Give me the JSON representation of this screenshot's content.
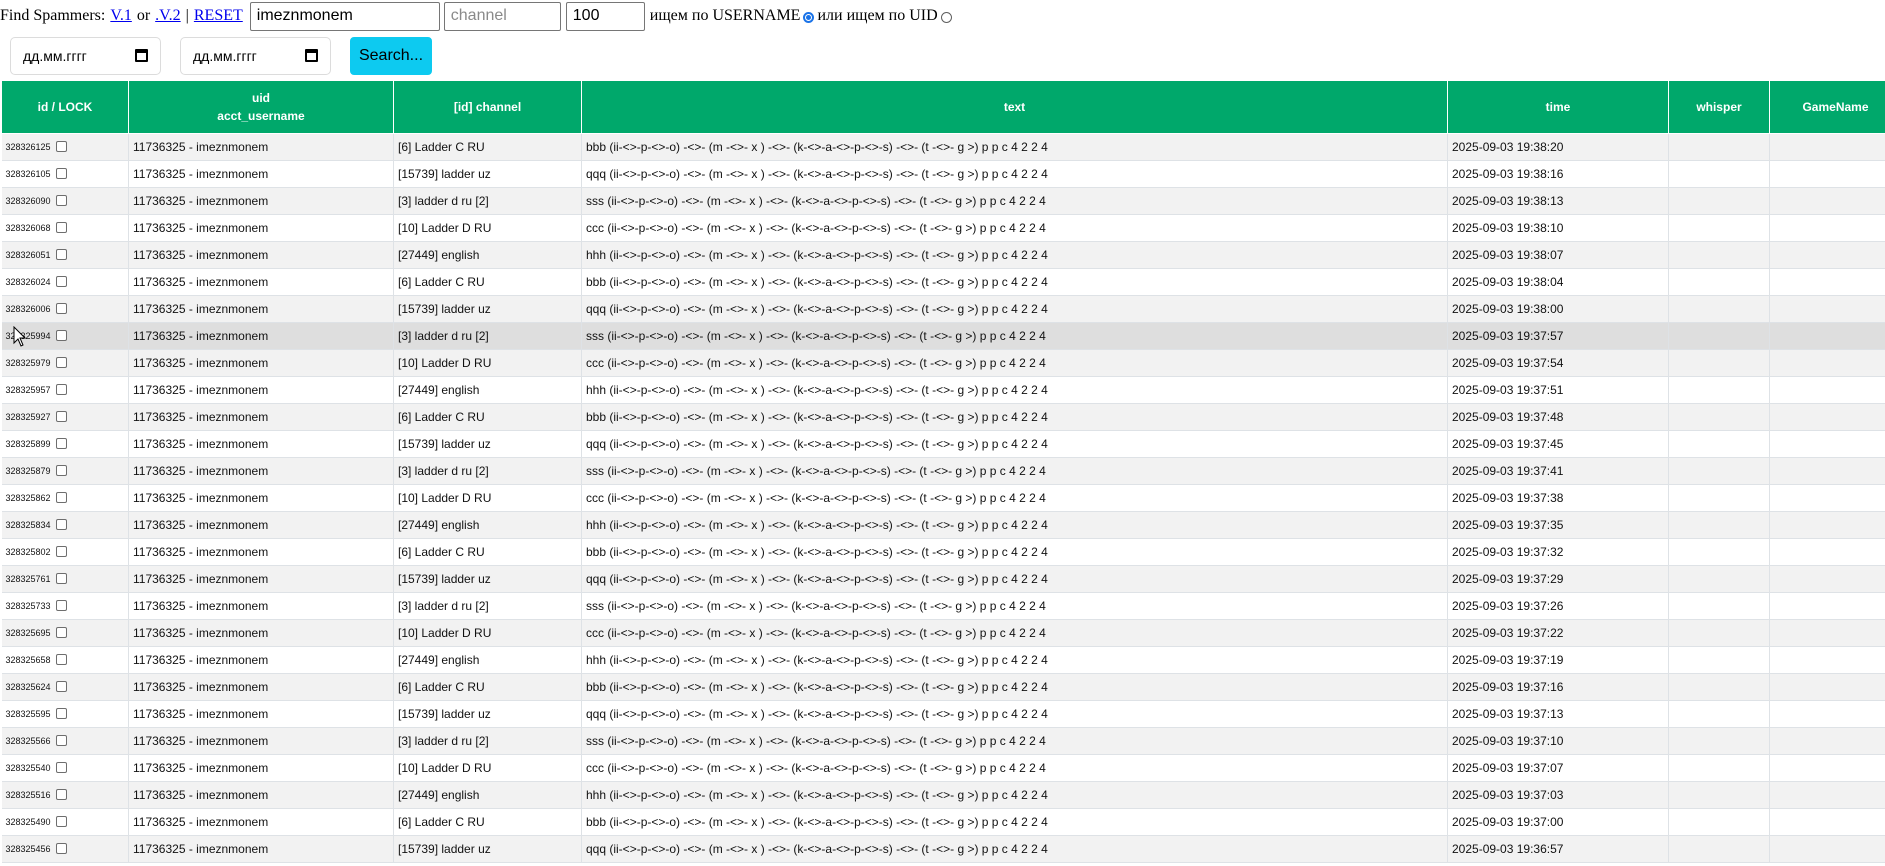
{
  "filters": {
    "find_label": "Find Spammers:",
    "v1_link": "V.1",
    "or_text": "or",
    "v2_link": ".V.2",
    "separator": "|",
    "reset_link": "RESET",
    "username_value": "imeznmonem",
    "channel_placeholder": "channel",
    "limit_value": "100",
    "by_username_label": "ищем по USERNAME",
    "by_uid_label": "или ищем по UID",
    "selected_mode": "username",
    "date_from_placeholder": "дд.мм.гггг",
    "date_to_placeholder": "дд.мм.гггг",
    "search_button": "Search..."
  },
  "colors": {
    "header_bg": "#00a86b",
    "button_bg": "#0dcaf0",
    "link": "#0000ee"
  },
  "table": {
    "columns": {
      "id_lock": "id / LOCK",
      "uid_line1": "uid",
      "uid_line2": "acct_username",
      "channel": "[id] channel",
      "text": "text",
      "time": "time",
      "whisper": "whisper",
      "gamename": "GameName"
    },
    "rows": [
      {
        "id": "328326125",
        "uid": "11736325 - imeznmonem",
        "channel": "[6] Ladder C RU",
        "text": "bbb (ii-<>-p-<>-o) -<>- (m -<>- x ) -<>- (k-<>-a-<>-p-<>-s) -<>- (t -<>- g >) p p c 4 2 2 4",
        "time": "2025-09-03 19:38:20"
      },
      {
        "id": "328326105",
        "uid": "11736325 - imeznmonem",
        "channel": "[15739] ladder uz",
        "text": "qqq (ii-<>-p-<>-o) -<>- (m -<>- x ) -<>- (k-<>-a-<>-p-<>-s) -<>- (t -<>- g >) p p c 4 2 2 4",
        "time": "2025-09-03 19:38:16"
      },
      {
        "id": "328326090",
        "uid": "11736325 - imeznmonem",
        "channel": "[3] ladder d ru [2]",
        "text": "sss (ii-<>-p-<>-o) -<>- (m -<>- x ) -<>- (k-<>-a-<>-p-<>-s) -<>- (t -<>- g >) p p c 4 2 2 4",
        "time": "2025-09-03 19:38:13"
      },
      {
        "id": "328326068",
        "uid": "11736325 - imeznmonem",
        "channel": "[10] Ladder D RU",
        "text": "ccc (ii-<>-p-<>-o) -<>- (m -<>- x ) -<>- (k-<>-a-<>-p-<>-s) -<>- (t -<>- g >) p p c 4 2 2 4",
        "time": "2025-09-03 19:38:10"
      },
      {
        "id": "328326051",
        "uid": "11736325 - imeznmonem",
        "channel": "[27449] english",
        "text": "hhh (ii-<>-p-<>-o) -<>- (m -<>- x ) -<>- (k-<>-a-<>-p-<>-s) -<>- (t -<>- g >) p p c 4 2 2 4",
        "time": "2025-09-03 19:38:07"
      },
      {
        "id": "328326024",
        "uid": "11736325 - imeznmonem",
        "channel": "[6] Ladder C RU",
        "text": "bbb (ii-<>-p-<>-o) -<>- (m -<>- x ) -<>- (k-<>-a-<>-p-<>-s) -<>- (t -<>- g >) p p c 4 2 2 4",
        "time": "2025-09-03 19:38:04"
      },
      {
        "id": "328326006",
        "uid": "11736325 - imeznmonem",
        "channel": "[15739] ladder uz",
        "text": "qqq (ii-<>-p-<>-o) -<>- (m -<>- x ) -<>- (k-<>-a-<>-p-<>-s) -<>- (t -<>- g >) p p c 4 2 2 4",
        "time": "2025-09-03 19:38:00"
      },
      {
        "id": "328325994",
        "uid": "11736325 - imeznmonem",
        "channel": "[3] ladder d ru [2]",
        "text": "sss (ii-<>-p-<>-o) -<>- (m -<>- x ) -<>- (k-<>-a-<>-p-<>-s) -<>- (t -<>- g >) p p c 4 2 2 4",
        "time": "2025-09-03 19:37:57",
        "hover": true
      },
      {
        "id": "328325979",
        "uid": "11736325 - imeznmonem",
        "channel": "[10] Ladder D RU",
        "text": "ccc (ii-<>-p-<>-o) -<>- (m -<>- x ) -<>- (k-<>-a-<>-p-<>-s) -<>- (t -<>- g >) p p c 4 2 2 4",
        "time": "2025-09-03 19:37:54"
      },
      {
        "id": "328325957",
        "uid": "11736325 - imeznmonem",
        "channel": "[27449] english",
        "text": "hhh (ii-<>-p-<>-o) -<>- (m -<>- x ) -<>- (k-<>-a-<>-p-<>-s) -<>- (t -<>- g >) p p c 4 2 2 4",
        "time": "2025-09-03 19:37:51"
      },
      {
        "id": "328325927",
        "uid": "11736325 - imeznmonem",
        "channel": "[6] Ladder C RU",
        "text": "bbb (ii-<>-p-<>-o) -<>- (m -<>- x ) -<>- (k-<>-a-<>-p-<>-s) -<>- (t -<>- g >) p p c 4 2 2 4",
        "time": "2025-09-03 19:37:48"
      },
      {
        "id": "328325899",
        "uid": "11736325 - imeznmonem",
        "channel": "[15739] ladder uz",
        "text": "qqq (ii-<>-p-<>-o) -<>- (m -<>- x ) -<>- (k-<>-a-<>-p-<>-s) -<>- (t -<>- g >) p p c 4 2 2 4",
        "time": "2025-09-03 19:37:45"
      },
      {
        "id": "328325879",
        "uid": "11736325 - imeznmonem",
        "channel": "[3] ladder d ru [2]",
        "text": "sss (ii-<>-p-<>-o) -<>- (m -<>- x ) -<>- (k-<>-a-<>-p-<>-s) -<>- (t -<>- g >) p p c 4 2 2 4",
        "time": "2025-09-03 19:37:41"
      },
      {
        "id": "328325862",
        "uid": "11736325 - imeznmonem",
        "channel": "[10] Ladder D RU",
        "text": "ccc (ii-<>-p-<>-o) -<>- (m -<>- x ) -<>- (k-<>-a-<>-p-<>-s) -<>- (t -<>- g >) p p c 4 2 2 4",
        "time": "2025-09-03 19:37:38"
      },
      {
        "id": "328325834",
        "uid": "11736325 - imeznmonem",
        "channel": "[27449] english",
        "text": "hhh (ii-<>-p-<>-o) -<>- (m -<>- x ) -<>- (k-<>-a-<>-p-<>-s) -<>- (t -<>- g >) p p c 4 2 2 4",
        "time": "2025-09-03 19:37:35"
      },
      {
        "id": "328325802",
        "uid": "11736325 - imeznmonem",
        "channel": "[6] Ladder C RU",
        "text": "bbb (ii-<>-p-<>-o) -<>- (m -<>- x ) -<>- (k-<>-a-<>-p-<>-s) -<>- (t -<>- g >) p p c 4 2 2 4",
        "time": "2025-09-03 19:37:32"
      },
      {
        "id": "328325761",
        "uid": "11736325 - imeznmonem",
        "channel": "[15739] ladder uz",
        "text": "qqq (ii-<>-p-<>-o) -<>- (m -<>- x ) -<>- (k-<>-a-<>-p-<>-s) -<>- (t -<>- g >) p p c 4 2 2 4",
        "time": "2025-09-03 19:37:29"
      },
      {
        "id": "328325733",
        "uid": "11736325 - imeznmonem",
        "channel": "[3] ladder d ru [2]",
        "text": "sss (ii-<>-p-<>-o) -<>- (m -<>- x ) -<>- (k-<>-a-<>-p-<>-s) -<>- (t -<>- g >) p p c 4 2 2 4",
        "time": "2025-09-03 19:37:26"
      },
      {
        "id": "328325695",
        "uid": "11736325 - imeznmonem",
        "channel": "[10] Ladder D RU",
        "text": "ccc (ii-<>-p-<>-o) -<>- (m -<>- x ) -<>- (k-<>-a-<>-p-<>-s) -<>- (t -<>- g >) p p c 4 2 2 4",
        "time": "2025-09-03 19:37:22"
      },
      {
        "id": "328325658",
        "uid": "11736325 - imeznmonem",
        "channel": "[27449] english",
        "text": "hhh (ii-<>-p-<>-o) -<>- (m -<>- x ) -<>- (k-<>-a-<>-p-<>-s) -<>- (t -<>- g >) p p c 4 2 2 4",
        "time": "2025-09-03 19:37:19"
      },
      {
        "id": "328325624",
        "uid": "11736325 - imeznmonem",
        "channel": "[6] Ladder C RU",
        "text": "bbb (ii-<>-p-<>-o) -<>- (m -<>- x ) -<>- (k-<>-a-<>-p-<>-s) -<>- (t -<>- g >) p p c 4 2 2 4",
        "time": "2025-09-03 19:37:16"
      },
      {
        "id": "328325595",
        "uid": "11736325 - imeznmonem",
        "channel": "[15739] ladder uz",
        "text": "qqq (ii-<>-p-<>-o) -<>- (m -<>- x ) -<>- (k-<>-a-<>-p-<>-s) -<>- (t -<>- g >) p p c 4 2 2 4",
        "time": "2025-09-03 19:37:13"
      },
      {
        "id": "328325566",
        "uid": "11736325 - imeznmonem",
        "channel": "[3] ladder d ru [2]",
        "text": "sss (ii-<>-p-<>-o) -<>- (m -<>- x ) -<>- (k-<>-a-<>-p-<>-s) -<>- (t -<>- g >) p p c 4 2 2 4",
        "time": "2025-09-03 19:37:10"
      },
      {
        "id": "328325540",
        "uid": "11736325 - imeznmonem",
        "channel": "[10] Ladder D RU",
        "text": "ccc (ii-<>-p-<>-o) -<>- (m -<>- x ) -<>- (k-<>-a-<>-p-<>-s) -<>- (t -<>- g >) p p c 4 2 2 4",
        "time": "2025-09-03 19:37:07"
      },
      {
        "id": "328325516",
        "uid": "11736325 - imeznmonem",
        "channel": "[27449] english",
        "text": "hhh (ii-<>-p-<>-o) -<>- (m -<>- x ) -<>- (k-<>-a-<>-p-<>-s) -<>- (t -<>- g >) p p c 4 2 2 4",
        "time": "2025-09-03 19:37:03"
      },
      {
        "id": "328325490",
        "uid": "11736325 - imeznmonem",
        "channel": "[6] Ladder C RU",
        "text": "bbb (ii-<>-p-<>-o) -<>- (m -<>- x ) -<>- (k-<>-a-<>-p-<>-s) -<>- (t -<>- g >) p p c 4 2 2 4",
        "time": "2025-09-03 19:37:00"
      },
      {
        "id": "328325456",
        "uid": "11736325 - imeznmonem",
        "channel": "[15739] ladder uz",
        "text": "qqq (ii-<>-p-<>-o) -<>- (m -<>- x ) -<>- (k-<>-a-<>-p-<>-s) -<>- (t -<>- g >) p p c 4 2 2 4",
        "time": "2025-09-03 19:36:57"
      }
    ]
  }
}
